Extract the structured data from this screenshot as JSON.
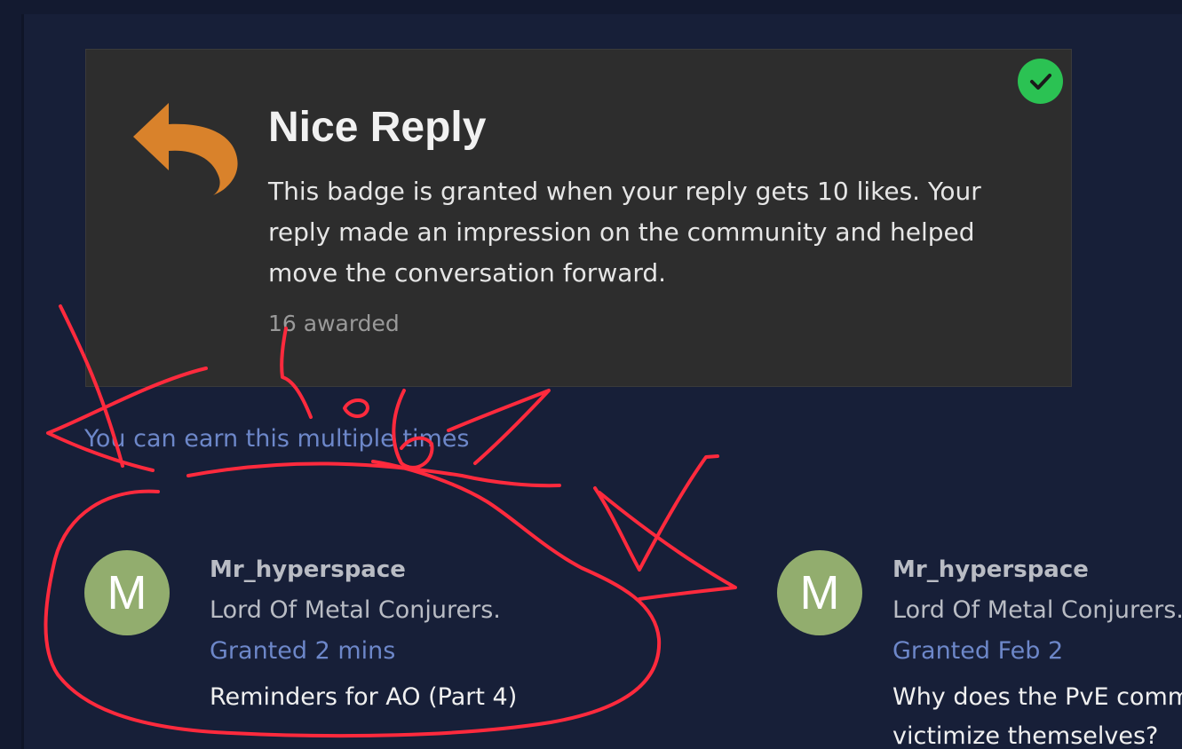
{
  "badge": {
    "title": "Nice Reply",
    "description": "This badge is granted when your reply gets 10 likes. Your reply made an impression on the community and helped move the conversation forward.",
    "awarded": "16 awarded",
    "icon": "reply-arrow-icon",
    "icon_color": "#d9822b",
    "granted_check_color": "#2bc253"
  },
  "earn_multiple": "You can earn this multiple times",
  "grants": [
    {
      "avatar_letter": "M",
      "username": "Mr_hyperspace",
      "user_title": "Lord Of Metal Conjurers.",
      "granted": "Granted 2 mins",
      "topic": "Reminders for AO (Part 4)"
    },
    {
      "avatar_letter": "M",
      "username": "Mr_hyperspace",
      "user_title": "Lord Of Metal Conjurers.",
      "granted": "Granted Feb 2",
      "topic": "Why does the PvE community victimize themselves?"
    }
  ],
  "colors": {
    "background": "#171f38",
    "card": "#2d2d2d",
    "link": "#6d87c9",
    "avatar": "#92ad6e",
    "annotation": "#ff2a3d"
  }
}
